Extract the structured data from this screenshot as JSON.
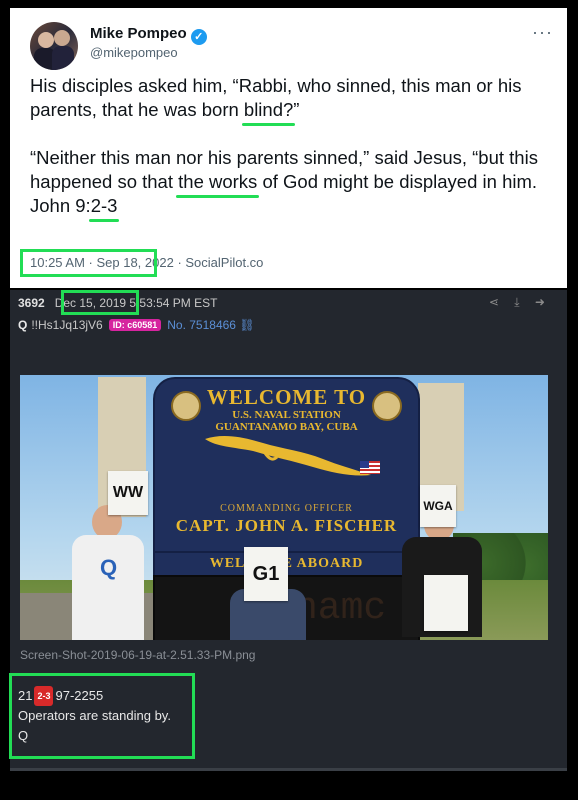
{
  "tweet": {
    "name": "Mike Pompeo",
    "handle": "@mikepompeo",
    "verified_icon": "verified-check-icon",
    "more_icon": "ellipsis-icon",
    "more_label": "···",
    "para1_pre": "His disciples asked him, “Rabbi, who sinned, this man or his parents, that he was born ",
    "para1_ul": "blind?",
    "para1_post": "”",
    "para2_pre": "“Neither this man nor his parents sinned,” said Jesus, “but this happened so that ",
    "para2_ul": "the works",
    "para2_post": " of God might be displayed in him.",
    "ref_pre": "John 9:",
    "ref_ul": "2-3",
    "time": "10:25 AM · Sep 18, ",
    "year_rest": "2022 · SocialPilot.co"
  },
  "qpost": {
    "number": "3692",
    "date": "Dec 15, 2019 5:53:54 PM EST",
    "author": "Q",
    "tripcode": "!!Hs1Jq13jV6",
    "id_badge": "ID: c60581",
    "post_no": "No. 7518466",
    "link_icon": "link-icon",
    "action_icons": "share-icon download-icon arrow-icon",
    "action_glyphs": "⋖ ⤓ ➜",
    "filename": "Screen-Shot-2019-06-19-at-2.51.33-PM.png",
    "line1_pre": "21",
    "line1_badge": "2-3",
    "line1_post": "97-2255",
    "line2": "Operators are standing by.",
    "line3": "Q"
  },
  "photo": {
    "sign_welcome": "WELCOME TO",
    "sign_station": "U.S. NAVAL STATION",
    "sign_location": "GUANTANAMO BAY, CUBA",
    "sign_officer": "COMMANDING OFFICER",
    "sign_capt": "CAPT. JOHN A. FISCHER",
    "sign_aboard": "WELCOME ABOARD",
    "card_ww": "WW",
    "card_g1": "G1",
    "card_wga": "WGA"
  },
  "colors": {
    "highlight": "#22dd55",
    "id_badge": "#d6249f",
    "red_badge": "#d82a2a",
    "panel_bg": "#23272e",
    "sign_blue": "#1f2f5c",
    "sign_gold": "#e8b830"
  }
}
